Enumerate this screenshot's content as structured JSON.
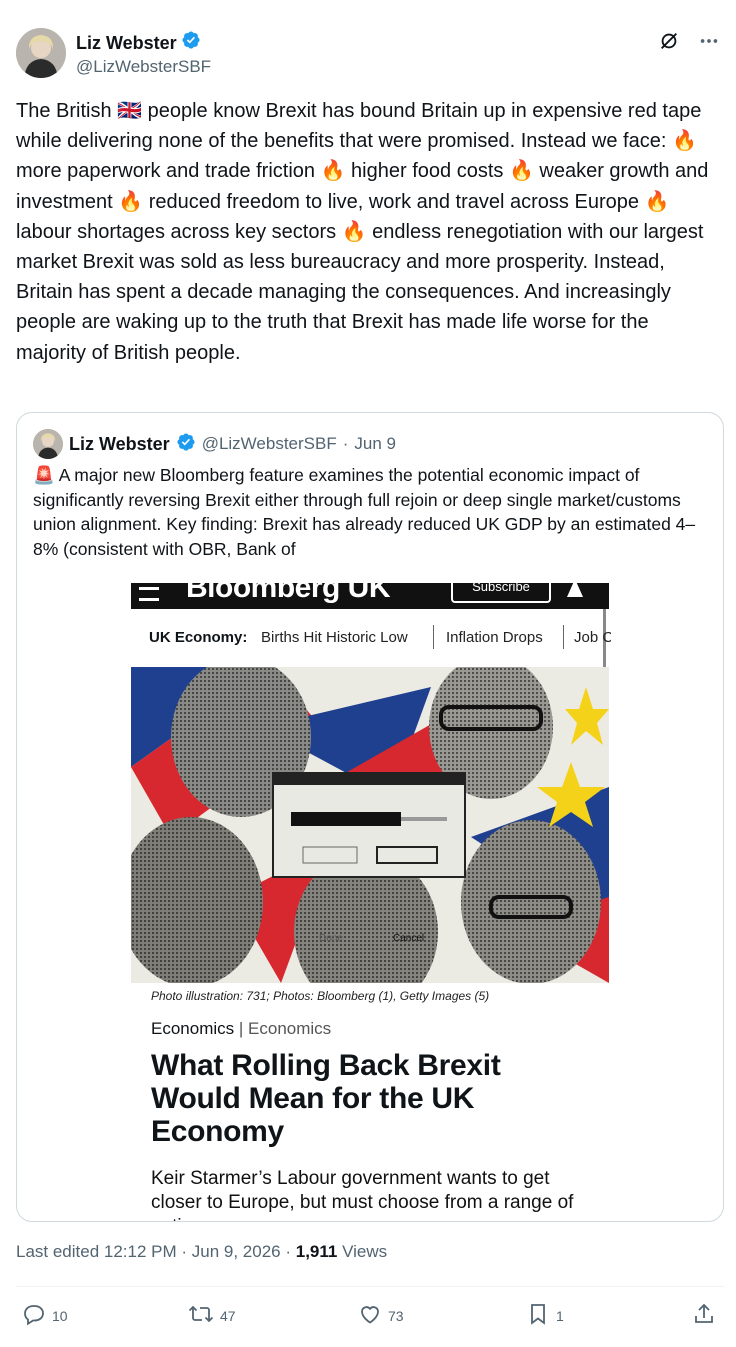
{
  "author": {
    "display_name": "Liz Webster",
    "handle": "@LizWebsterSBF"
  },
  "tweet": {
    "text_parts": [
      "The British ",
      " people know Brexit has bound Britain up in expensive red tape while delivering none of the benefits that were promised. Instead we face: ",
      " more paperwork and trade friction ",
      " higher food costs ",
      " weaker growth and investment ",
      " reduced freedom to live, work and travel across Europe ",
      " labour shortages across key sectors ",
      " endless renegotiation with our largest market Brexit was sold as less bureaucracy and more prosperity. Instead, Britain has spent a decade managing the consequences. And increasingly people are waking up to the truth that Brexit has made life worse for the majority of British people."
    ],
    "emoji": {
      "flag": "🇬🇧",
      "fire": "🔥"
    }
  },
  "quote": {
    "display_name": "Liz Webster",
    "handle": "@LizWebsterSBF",
    "dot": "·",
    "date": "Jun 9",
    "siren": "🚨",
    "text": " A major new Bloomberg feature examines the potential economic impact of significantly reversing Brexit either through full rejoin or deep single market/customs union alignment. Key finding: Brexit has already reduced UK GDP by an estimated 4–8% (consistent with OBR, Bank of",
    "article": {
      "masthead": "Bloomberg UK",
      "subscribe": "Subscribe",
      "topic_label": "UK Economy:",
      "topic_links": [
        "Births Hit Historic Low",
        "Inflation Drops",
        "Job C"
      ],
      "dialog_done": "Done",
      "dialog_cancel": "Cancel",
      "caption": "Photo illustration: 731; Photos: Bloomberg (1), Getty Images (5)",
      "section": "Economics",
      "section_sep": "|",
      "subsection": "Economics",
      "headline": "What Rolling Back Brexit Would Mean for the UK Economy",
      "dek": "Keir Starmer’s Labour government wants to get closer to Europe, but must choose from a range of options"
    }
  },
  "meta": {
    "edited": "Last edited 12:12 PM · Jun 9, 2026 · ",
    "views_count": "1,911",
    "views_label": " Views"
  },
  "actions": {
    "replies": "10",
    "reposts": "47",
    "likes": "73",
    "bookmarks": "1"
  },
  "colors": {
    "verified": "#1d9bf0",
    "text_secondary": "#536471",
    "border": "#cfd9de",
    "flag_red": "#d7282f",
    "flag_blue": "#1f3f8f",
    "eu_yellow": "#f5d21a"
  }
}
